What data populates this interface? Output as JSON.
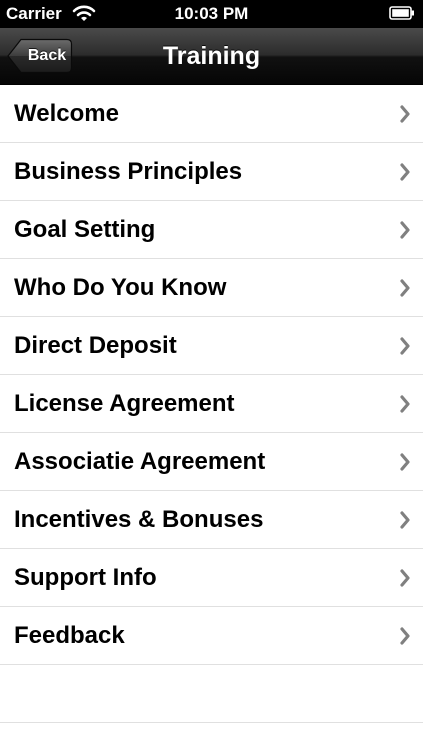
{
  "status_bar": {
    "carrier": "Carrier",
    "time": "10:03 PM",
    "wifi_icon": "wifi-icon",
    "battery_icon": "battery-icon"
  },
  "nav_bar": {
    "back_label": "Back",
    "title": "Training"
  },
  "list": {
    "items": [
      {
        "label": "Welcome"
      },
      {
        "label": "Business Principles"
      },
      {
        "label": "Goal Setting"
      },
      {
        "label": "Who Do You Know"
      },
      {
        "label": "Direct Deposit"
      },
      {
        "label": "License Agreement"
      },
      {
        "label": "Associatie Agreement"
      },
      {
        "label": "Incentives & Bonuses"
      },
      {
        "label": "Support Info"
      },
      {
        "label": "Feedback"
      }
    ],
    "chevron_icon": "chevron-right-icon"
  },
  "colors": {
    "status_bar_bg": "#000000",
    "nav_bar_top": "#4a4a4a",
    "nav_bar_bottom": "#050505",
    "separator": "#e0e0e0",
    "chevron": "#808080",
    "text": "#000000"
  }
}
